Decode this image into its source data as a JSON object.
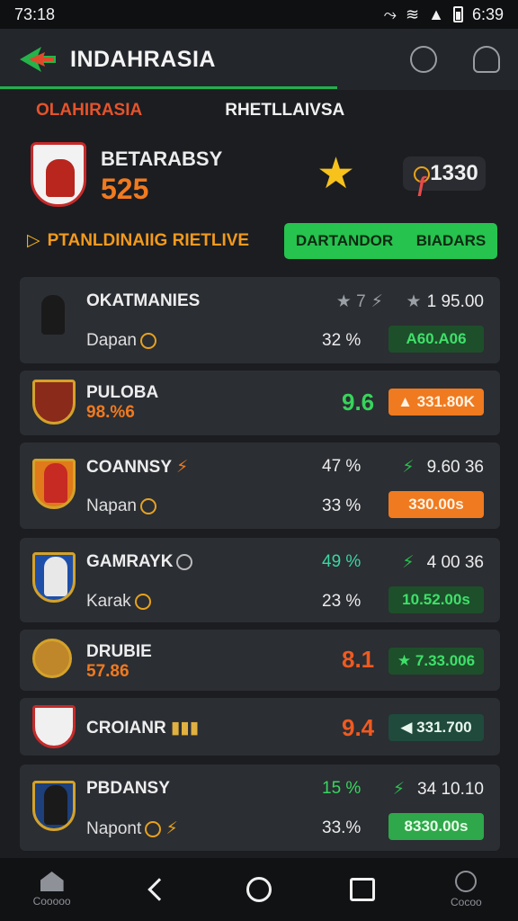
{
  "status_bar": {
    "time": "73:18",
    "clock_right": "6:39"
  },
  "header": {
    "title": "INDAHRASIA",
    "logo_icon": "arrow-logo-icon",
    "icons": [
      "target-icon",
      "bell-icon"
    ]
  },
  "tabs": [
    {
      "label": "OLAHIRASIA",
      "active": true
    },
    {
      "label": "RHETLLAIVSA",
      "active": false
    }
  ],
  "profile": {
    "name": "BETARABSY",
    "score": "525",
    "coins": "1330",
    "coin_prefix": "ƒ"
  },
  "banner": {
    "promo": "PTANLDINAIIG RIETLIVE",
    "button_left": "DARTANDOR",
    "button_right": "BIADARS"
  },
  "players": [
    {
      "name": "OKATMANIES",
      "sub": "Dapan",
      "stat_a": "★ 7",
      "stat_b": "1 95.00",
      "pct": "32 %",
      "pill": "A60.A06",
      "pill_style": "green"
    },
    {
      "name": "PULOBA",
      "sub": "98.%6",
      "rating": "9.6",
      "rating_color": "#37d45a",
      "pill": "331.80K",
      "pill_style": "orange"
    },
    {
      "name": "COANNSY",
      "sub": "Napan",
      "pct_top": "47 %",
      "stat_b": "9.60 36",
      "pct": "33 %",
      "pill": "330.00s",
      "pill_style": "orange"
    },
    {
      "name": "GAMRAYK",
      "sub": "Karak",
      "pct_top": "49 %",
      "stat_b": "4 00 36",
      "pct": "23 %",
      "pill": "10.52.00s",
      "pill_style": "green"
    },
    {
      "name": "DRUBIE",
      "sub": "57.86",
      "rating": "8.1",
      "rating_color": "#f05a20",
      "pill": "7.33.006",
      "pill_style": "green"
    },
    {
      "name": "CROIANR",
      "rating": "9.4",
      "rating_color": "#f05a20",
      "pill": "331.700",
      "pill_style": "teal"
    },
    {
      "name": "PBDANSY",
      "sub": "Napont",
      "pct_top": "15 %",
      "stat_b": "34 10.10",
      "pct": "33.%",
      "pill": "8330.00s",
      "pill_style": "bright"
    }
  ],
  "nav": {
    "home_label": "Cooooo",
    "mic_label": "Cocoo"
  }
}
